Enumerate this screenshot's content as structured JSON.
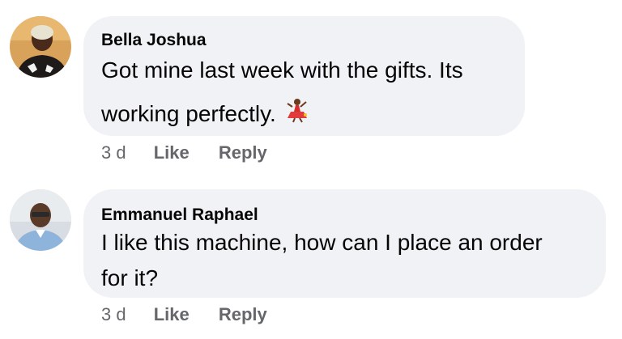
{
  "comments": [
    {
      "author": "Bella Joshua",
      "text_line1": "Got mine last week with the gifts. Its",
      "text_line2": "working perfectly.",
      "emoji_icon": "dancer-emoji-icon",
      "time": "3 d",
      "like_label": "Like",
      "reply_label": "Reply"
    },
    {
      "author": "Emmanuel Raphael",
      "text_line1": "I like this machine, how can I place an order",
      "text_line2": "for it?",
      "time": "3 d",
      "like_label": "Like",
      "reply_label": "Reply"
    }
  ],
  "colors": {
    "bubble": "#f0f2f5",
    "meta_text": "#65676b",
    "body_text": "#050505"
  }
}
